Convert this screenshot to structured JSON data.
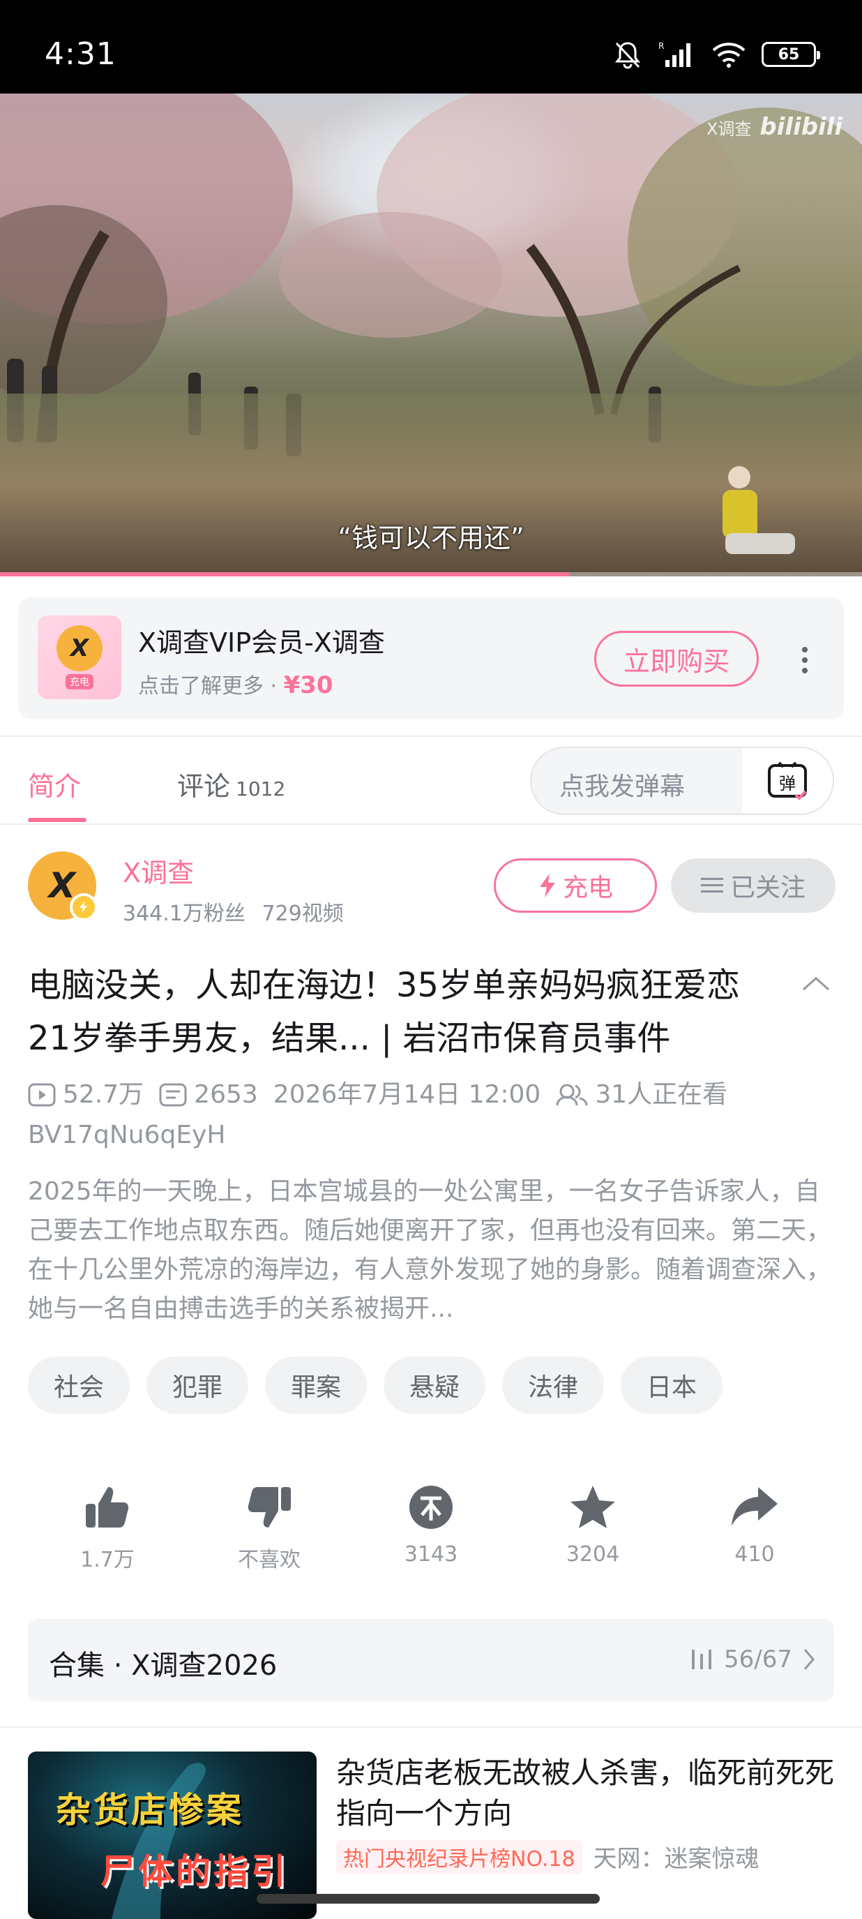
{
  "status_bar": {
    "time": "4:31",
    "battery": "65"
  },
  "video": {
    "subtitle": "“钱可以不用还”",
    "watermark_text": "X调查",
    "watermark_brand": "bilibili",
    "progress_fraction": 0.66
  },
  "ad": {
    "logo_text": "X",
    "logo_tag": "充电",
    "title": "X调查VIP会员-X调查",
    "subtitle": "点击了解更多 · ",
    "price": "¥30",
    "buy_label": "立即购买"
  },
  "tabs": {
    "intro": "简介",
    "comments": "评论",
    "comment_count": "1012",
    "danmaku_placeholder": "点我发弹幕",
    "danmaku_icon_text": "弹"
  },
  "uploader": {
    "avatar_text": "X",
    "name": "X调查",
    "followers": "344.1万粉丝",
    "videos": "729视频",
    "charge_label": "充电",
    "follow_label": "已关注"
  },
  "video_info": {
    "title": "电脑没关，人却在海边！35岁单亲妈妈疯狂爱恋21岁拳手男友，结果... | 岩沼市保育员事件",
    "plays": "52.7万",
    "danmaku_count": "2653",
    "date": "2026年7月14日 12:00",
    "watching": "31人正在看",
    "bvid": "BV17qNu6qEyH",
    "description": "2025年的一天晚上，日本宫城县的一处公寓里，一名女子告诉家人，自己要去工作地点取东西。随后她便离开了家，但再也没有回来。第二天，在十几公里外荒凉的海岸边，有人意外发现了她的身影。随着调查深入，她与一名自由搏击选手的关系被揭开..."
  },
  "tags": [
    "社会",
    "犯罪",
    "罪案",
    "悬疑",
    "法律",
    "日本"
  ],
  "actions": {
    "like": "1.7万",
    "dislike": "不喜欢",
    "coin": "3143",
    "favorite": "3204",
    "share": "410"
  },
  "collection": {
    "label": "合集 · X调查2026",
    "progress": "56/67"
  },
  "recommended": {
    "thumb_line1": "杂货店惨案",
    "thumb_line2": "尸体的指引",
    "title": "杂货店老板无故被人杀害，临死前死死指向一个方向",
    "badge": "热门央视纪录片榜NO.18",
    "author": "天网：迷案惊魂"
  },
  "colors": {
    "accent": "#fb7299",
    "gray_text": "#9499a0",
    "avatar_yellow": "#f6b23c"
  }
}
